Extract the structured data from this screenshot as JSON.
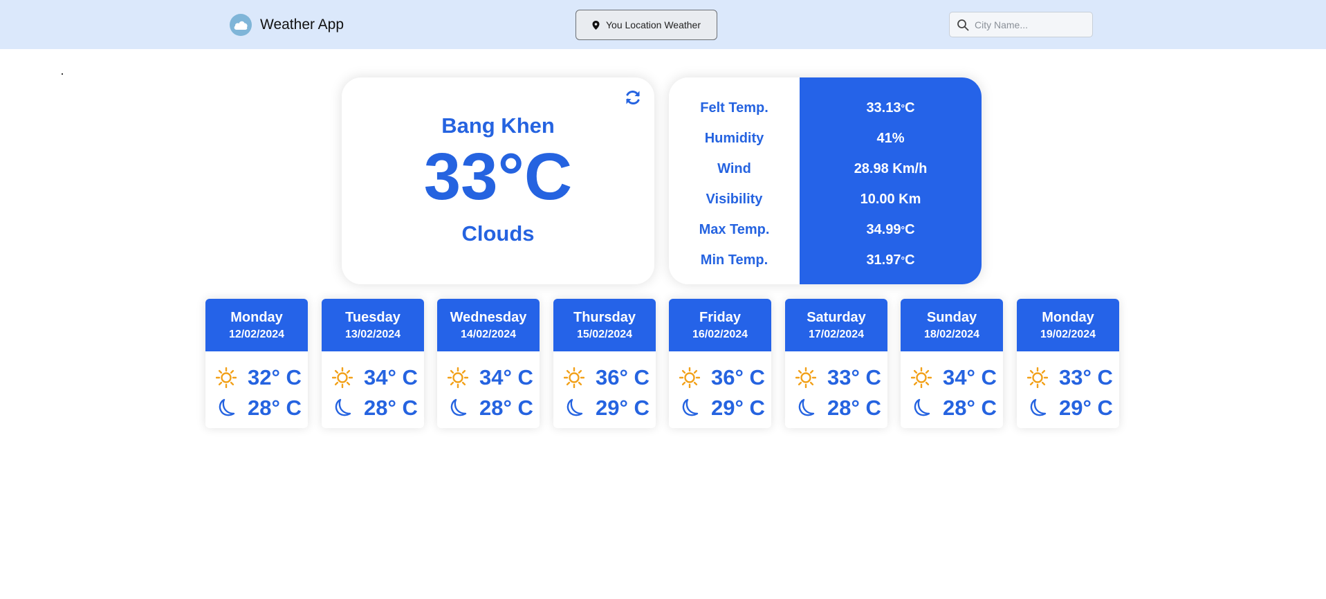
{
  "navbar": {
    "app_title": "Weather App",
    "logo_icon": "cloud-icon",
    "location_button_label": "You Location Weather",
    "location_icon": "map-pin-icon",
    "search_placeholder": "City Name...",
    "search_value": "",
    "search_icon": "search-icon"
  },
  "current": {
    "city": "Bang Khen",
    "temperature": "33°C",
    "condition": "Clouds",
    "refresh_icon": "refresh-icon"
  },
  "details": [
    {
      "label": "Felt Temp.",
      "value": "33.13",
      "unit": "C"
    },
    {
      "label": "Humidity",
      "value": "41%"
    },
    {
      "label": "Wind",
      "value": "28.98 Km/h"
    },
    {
      "label": "Visibility",
      "value": "10.00 Km"
    },
    {
      "label": "Max Temp.",
      "value": "34.99",
      "unit": "C"
    },
    {
      "label": "Min Temp.",
      "value": "31.97",
      "unit": "C"
    }
  ],
  "forecast": [
    {
      "day": "Monday",
      "date": "12/02/2024",
      "day_temp": "32° C",
      "night_temp": "28° C"
    },
    {
      "day": "Tuesday",
      "date": "13/02/2024",
      "day_temp": "34° C",
      "night_temp": "28° C"
    },
    {
      "day": "Wednesday",
      "date": "14/02/2024",
      "day_temp": "34° C",
      "night_temp": "28° C"
    },
    {
      "day": "Thursday",
      "date": "15/02/2024",
      "day_temp": "36° C",
      "night_temp": "29° C"
    },
    {
      "day": "Friday",
      "date": "16/02/2024",
      "day_temp": "36° C",
      "night_temp": "29° C"
    },
    {
      "day": "Saturday",
      "date": "17/02/2024",
      "day_temp": "33° C",
      "night_temp": "28° C"
    },
    {
      "day": "Sunday",
      "date": "18/02/2024",
      "day_temp": "34° C",
      "night_temp": "28° C"
    },
    {
      "day": "Monday",
      "date": "19/02/2024",
      "day_temp": "33° C",
      "night_temp": "29° C"
    }
  ],
  "colors": {
    "accent": "#2563e8",
    "navbar_bg": "#dbe8fb",
    "sun": "#f2a11a",
    "moon": "#2563e0"
  }
}
